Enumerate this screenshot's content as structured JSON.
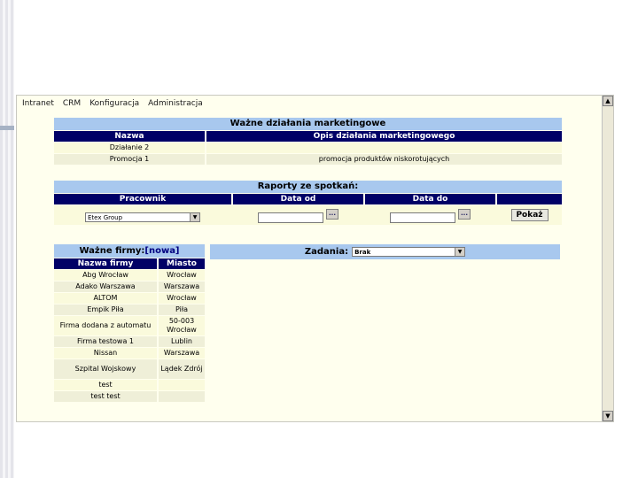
{
  "menu": [
    "Intranet",
    "CRM",
    "Konfiguracja",
    "Administracja"
  ],
  "marketing": {
    "title": "Ważne działania marketingowe",
    "columns": [
      "Nazwa",
      "Opis działania marketingowego"
    ],
    "rows": [
      [
        "Działanie 2",
        ""
      ],
      [
        "Promocja 1",
        "promocja produktów niskorotujących"
      ]
    ]
  },
  "reports": {
    "title": "Raporty ze spotkań:",
    "columns": [
      "Pracownik",
      "Data od",
      "Data do"
    ],
    "employee_value": "Etex Group",
    "dots_label": "...",
    "show_button": "Pokaż"
  },
  "firms": {
    "title": "Ważne firmy:",
    "new_link": "[nowa]",
    "columns": [
      "Nazwa firmy",
      "Miasto"
    ],
    "rows": [
      [
        "Abg Wrocław",
        "Wrocław"
      ],
      [
        "Adako Warszawa",
        "Warszawa"
      ],
      [
        "ALTOM",
        "Wrocław"
      ],
      [
        "Empik Piła",
        "Piła"
      ],
      [
        "Firma dodana z automatu",
        "50-003 Wrocław"
      ],
      [
        "Firma testowa 1",
        "Lublin"
      ],
      [
        "Nissan",
        "Warszawa"
      ],
      [
        "Szpital Wojskowy",
        "Lądek Zdrój"
      ],
      [
        "test",
        ""
      ],
      [
        "test test",
        ""
      ]
    ]
  },
  "tasks": {
    "label": "Zadania:",
    "value": "Brak"
  },
  "scroll": {
    "up": "▲",
    "down": "▼"
  }
}
